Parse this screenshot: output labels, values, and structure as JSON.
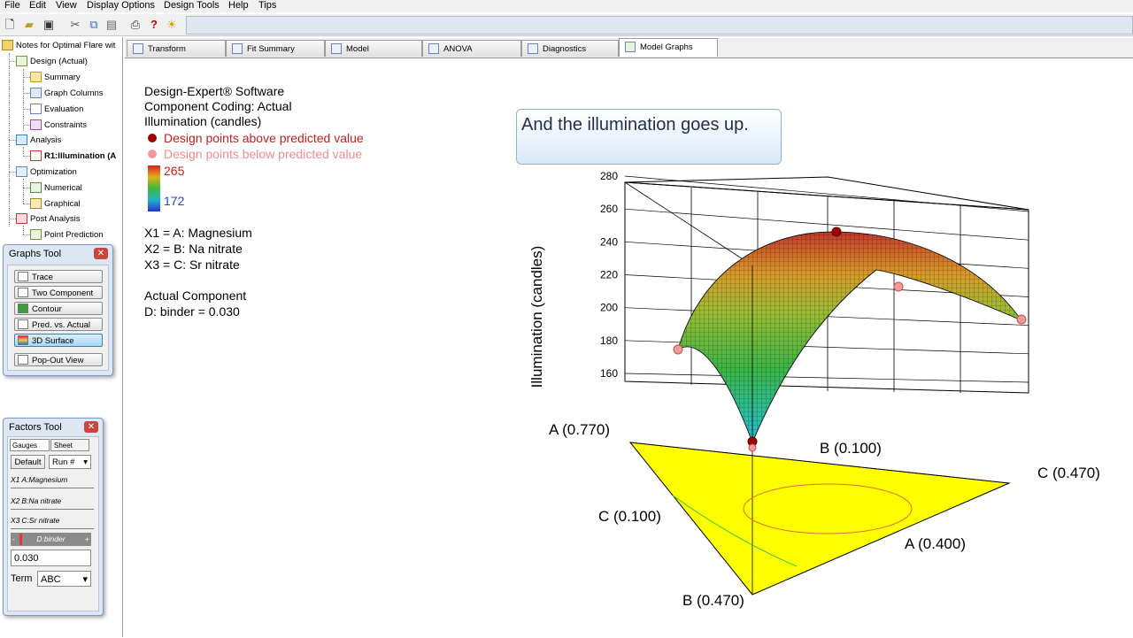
{
  "menu": [
    "File",
    "Edit",
    "View",
    "Display Options",
    "Design Tools",
    "Help",
    "Tips"
  ],
  "toolbar_icons": [
    "new-icon",
    "open-icon",
    "save-icon",
    "cut-icon",
    "copy-icon",
    "paste-icon",
    "print-icon",
    "help-icon",
    "tip-bulb-icon"
  ],
  "tree": {
    "root": "Notes for Optimal Flare wit",
    "items": [
      {
        "label": "Design (Actual)",
        "level": 1,
        "bold": false
      },
      {
        "label": "Summary",
        "level": 2,
        "bold": false
      },
      {
        "label": "Graph Columns",
        "level": 2,
        "bold": false
      },
      {
        "label": "Evaluation",
        "level": 2,
        "bold": false
      },
      {
        "label": "Constraints",
        "level": 2,
        "bold": false
      },
      {
        "label": "Analysis",
        "level": 1,
        "bold": false
      },
      {
        "label": "R1:Illumination (A",
        "level": 2,
        "bold": true
      },
      {
        "label": "Optimization",
        "level": 1,
        "bold": false
      },
      {
        "label": "Numerical",
        "level": 2,
        "bold": false
      },
      {
        "label": "Graphical",
        "level": 2,
        "bold": false
      },
      {
        "label": "Post Analysis",
        "level": 1,
        "bold": false
      },
      {
        "label": "Point Prediction",
        "level": 2,
        "bold": false
      }
    ]
  },
  "tabs": [
    "Transform",
    "Fit Summary",
    "Model",
    "ANOVA",
    "Diagnostics",
    "Model Graphs"
  ],
  "active_tab": "Model Graphs",
  "graphs_tool": {
    "title": "Graphs Tool",
    "buttons": [
      "Trace",
      "Two Component",
      "Contour",
      "Pred. vs. Actual",
      "3D Surface"
    ],
    "selected": "3D Surface",
    "popout": "Pop-Out View"
  },
  "factors_tool": {
    "title": "Factors Tool",
    "tab_gauges": "Gauges",
    "tab_sheet": "Sheet",
    "default_btn": "Default",
    "run_select": "Run #",
    "factors": [
      {
        "id": "X1",
        "name": "A:Magnesium"
      },
      {
        "id": "X2",
        "name": "B:Na nitrate"
      },
      {
        "id": "X3",
        "name": "C:Sr nitrate"
      }
    ],
    "slider_label": "D:binder",
    "slider_minus": "-",
    "slider_plus": "+",
    "value": "0.030",
    "term_label": "Term",
    "term_value": "ABC"
  },
  "legend": {
    "line1": "Design-Expert® Software",
    "line2": "Component Coding: Actual",
    "line3": "Illumination (candles)",
    "above": "Design points above predicted value",
    "below": "Design points below predicted value",
    "max": "265",
    "min": "172",
    "x1": "X1 = A: Magnesium",
    "x2": "X2 = B: Na nitrate",
    "x3": "X3 = C: Sr nitrate",
    "actual": "Actual Component",
    "binder": "D: binder = 0.030"
  },
  "callout": "And the illumination goes up.",
  "chart_data": {
    "type": "surface",
    "zlabel": "Illumination (candles)",
    "z_ticks": [
      "160",
      "180",
      "200",
      "220",
      "240",
      "260",
      "280"
    ],
    "zlim": [
      160,
      280
    ],
    "vertex_labels": [
      "A (0.770)",
      "B (0.100)",
      "C (0.470)",
      "C (0.100)",
      "A (0.400)",
      "B (0.470)"
    ],
    "colors": {
      "high": "#c0392b",
      "low": "#2a3fd0",
      "base": "#ffff00",
      "above_point": "#a00000",
      "below_point": "#f29a9a"
    }
  }
}
